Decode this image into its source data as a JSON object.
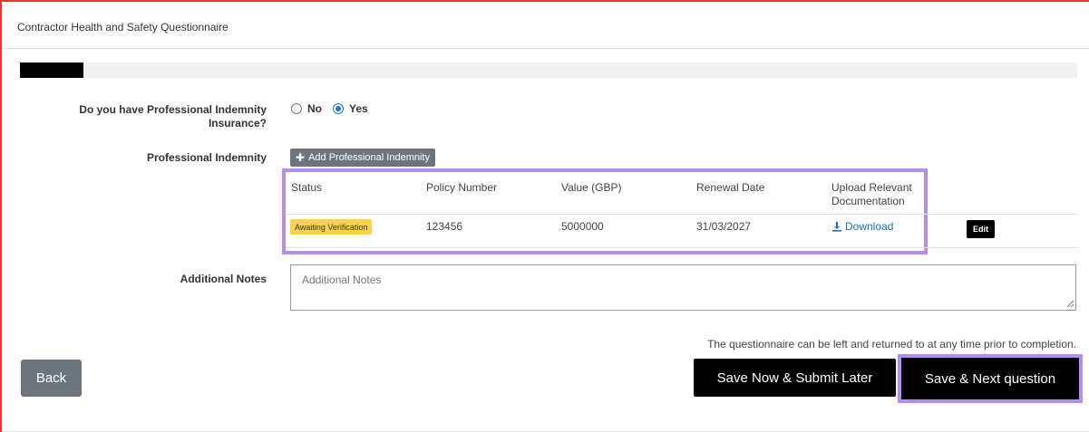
{
  "header": {
    "title": "Contractor Health and Safety Questionnaire"
  },
  "progress": {
    "fraction": 0.06
  },
  "question": {
    "label": "Do you have Professional Indemnity Insurance?",
    "options": [
      {
        "label": "No",
        "checked": false
      },
      {
        "label": "Yes",
        "checked": true
      }
    ]
  },
  "indemnity": {
    "label": "Professional Indemnity",
    "add_button": "Add Professional Indemnity",
    "columns": [
      "Status",
      "Policy Number",
      "Value (GBP)",
      "Renewal Date",
      "Upload Relevant Documentation"
    ],
    "rows": [
      {
        "status": "Awaiting Verification",
        "policy_number": "123456",
        "value": "5000000",
        "renewal_date": "31/03/2027",
        "upload": "Download",
        "edit": "Edit"
      }
    ]
  },
  "notes": {
    "label": "Additional Notes",
    "placeholder": "Additional Notes"
  },
  "footer": {
    "hint": "The questionnaire can be left and returned to at any time prior to completion.",
    "back": "Back",
    "save_later": "Save Now & Submit Later",
    "save_next": "Save & Next question"
  },
  "colors": {
    "accent_highlight": "#b58cf0",
    "status_badge": "#fbd14b",
    "link": "#1a6fbf",
    "radio": "#1a73e8"
  }
}
